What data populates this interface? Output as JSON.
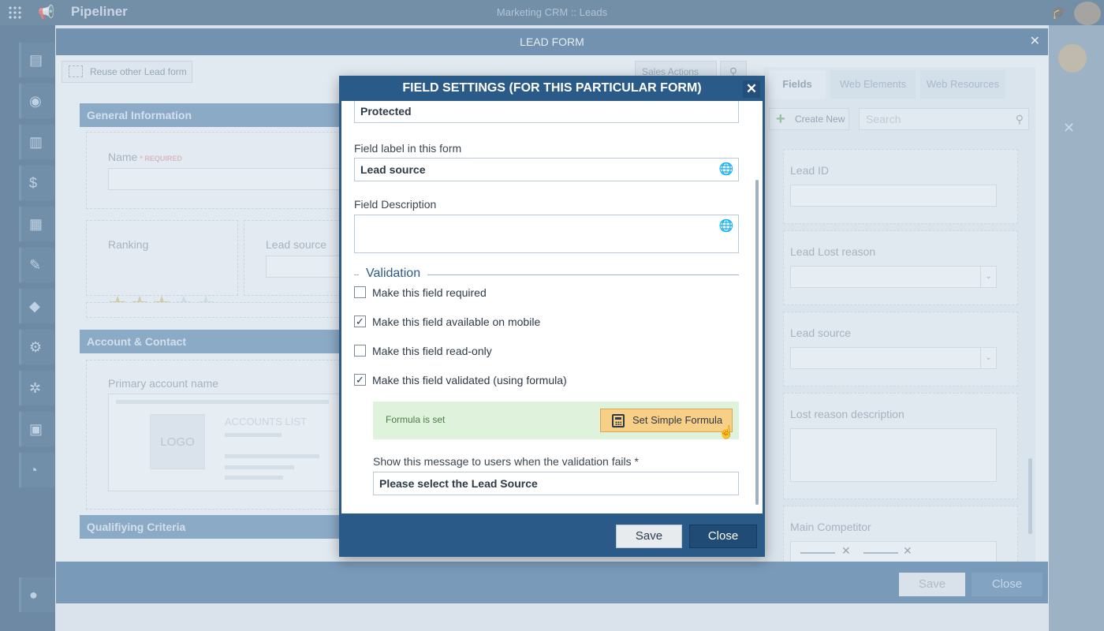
{
  "app": {
    "logo": "Pipeliner",
    "window_title": "Marketing CRM :: Leads"
  },
  "lead_form": {
    "title": "LEAD FORM",
    "reuse_label": "Reuse other Lead form",
    "sales_actions": "Sales Actions",
    "sections": {
      "general": "General Information",
      "account": "Account & Contact",
      "qualifying": "Qualifiying Criteria"
    },
    "fields": {
      "name_label": "Name",
      "name_required": "* REQUIRED",
      "ranking_label": "Ranking",
      "ranking_value": 3,
      "ranking_max": 5,
      "lead_source_label": "Lead source",
      "primary_account_label": "Primary account name",
      "logo_text": "LOGO",
      "accounts_list_text": "ACCOUNTS LIST"
    },
    "footer": {
      "save": "Save",
      "close": "Close"
    }
  },
  "palette": {
    "tabs": [
      "Fields",
      "Web Elements",
      "Web Resources"
    ],
    "active_tab": "Fields",
    "create_new": "Create New",
    "search_placeholder": "Search",
    "fields": [
      {
        "label": "Lead ID",
        "type": "text"
      },
      {
        "label": "Lead Lost reason",
        "type": "dropdown"
      },
      {
        "label": "Lead source",
        "type": "dropdown"
      },
      {
        "label": "Lost reason description",
        "type": "textarea"
      },
      {
        "label": "Main Competitor",
        "type": "multi"
      }
    ]
  },
  "modal": {
    "title": "FIELD SETTINGS (FOR THIS PARTICULAR FORM)",
    "protected_value": "Protected",
    "field_label_caption": "Field label in this form",
    "field_label_value": "Lead source",
    "field_description_caption": "Field Description",
    "validation_legend": "Validation",
    "checkboxes": [
      {
        "label": "Make this field required",
        "checked": false
      },
      {
        "label": "Make this field available on mobile",
        "checked": true
      },
      {
        "label": "Make this field read-only",
        "checked": false
      },
      {
        "label": "Make this field validated (using formula)",
        "checked": true
      }
    ],
    "formula_status": "Formula is set",
    "formula_button": "Set Simple Formula",
    "message_caption": "Show this message to users when the validation fails *",
    "message_value": "Please select the Lead Source",
    "save": "Save",
    "close": "Close"
  }
}
